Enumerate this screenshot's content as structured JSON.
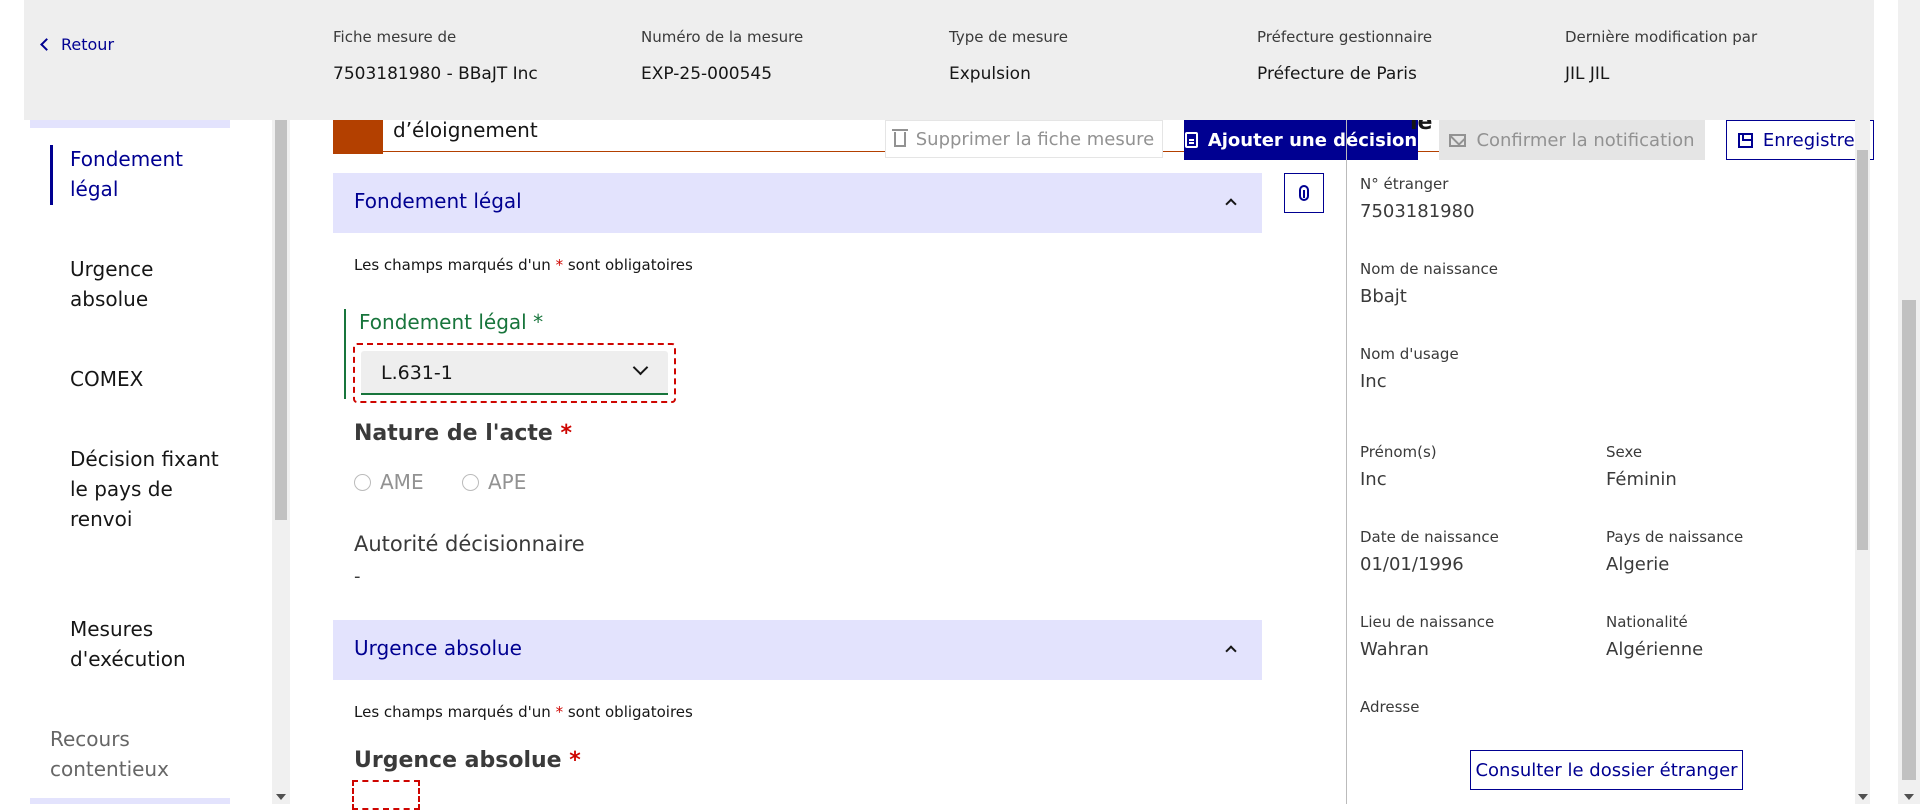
{
  "header": {
    "back_label": "Retour",
    "fields": [
      {
        "label": "Fiche mesure de",
        "value": "7503181980 - BBaJT Inc"
      },
      {
        "label": "Numéro de la mesure",
        "value": "EXP-25-000545"
      },
      {
        "label": "Type de mesure",
        "value": "Expulsion"
      },
      {
        "label": "Préfecture gestionnaire",
        "value": "Préfecture de Paris"
      },
      {
        "label": "Dernière modification par",
        "value": "JIL JIL"
      }
    ]
  },
  "sidebar": {
    "items": [
      {
        "label": "Fondement légal"
      },
      {
        "label": "Urgence absolue"
      },
      {
        "label": "COMEX"
      },
      {
        "label": "Décision fixant le pays de renvoi"
      },
      {
        "label": "Mesures d'exécution"
      }
    ],
    "group_label": "Recours contentieux"
  },
  "toolbar": {
    "delete_label": "Supprimer la fiche mesure",
    "add_decision_label": "Ajouter une décision",
    "confirm_notification_label": "Confirmer la notification",
    "save_label": "Enregistrer"
  },
  "banner": {
    "text": "d’éloignement"
  },
  "sections": {
    "fondement": {
      "title": "Fondement légal",
      "mandatory_prefix": "Les champs marqués d'un",
      "mandatory_star": "*",
      "mandatory_suffix": "sont obligatoires",
      "field_label": "Fondement légal",
      "field_star": "*",
      "select_value": "L.631-1",
      "nature_label": "Nature de l'acte",
      "nature_star": "*",
      "nature_options": [
        "AME",
        "APE"
      ],
      "autorite_label": "Autorité décisionnaire",
      "autorite_value": "-"
    },
    "urgence": {
      "title": "Urgence absolue",
      "mandatory_prefix": "Les champs marqués d'un",
      "mandatory_star": "*",
      "mandatory_suffix": "sont obligatoires",
      "field_label": "Urgence absolue",
      "field_star": "*"
    }
  },
  "panel": {
    "title_fragment": "le",
    "fields": {
      "numero_etranger": {
        "label": "N° étranger",
        "value": "7503181980"
      },
      "nom_naissance": {
        "label": "Nom de naissance",
        "value": "Bbajt"
      },
      "nom_usage": {
        "label": "Nom d'usage",
        "value": "Inc"
      },
      "prenoms": {
        "label": "Prénom(s)",
        "value": "Inc"
      },
      "sexe": {
        "label": "Sexe",
        "value": "Féminin"
      },
      "date_naissance": {
        "label": "Date de naissance",
        "value": "01/01/1996"
      },
      "pays_naissance": {
        "label": "Pays de naissance",
        "value": "Algerie"
      },
      "lieu_naissance": {
        "label": "Lieu de naissance",
        "value": "Wahran"
      },
      "nationalite": {
        "label": "Nationalité",
        "value": "Algérienne"
      },
      "adresse": {
        "label": "Adresse"
      }
    },
    "consult_label": "Consulter le dossier étranger"
  },
  "colors": {
    "primary": "#000091",
    "section_bg": "#e3e3fd",
    "success": "#18753c",
    "error": "#ce0500",
    "banner_accent": "#b34000"
  },
  "icons": [
    "chevron-left-icon",
    "trash-icon",
    "document-icon",
    "mail-icon",
    "save-icon",
    "paperclip-icon",
    "chevron-up-icon",
    "chevron-down-icon"
  ]
}
